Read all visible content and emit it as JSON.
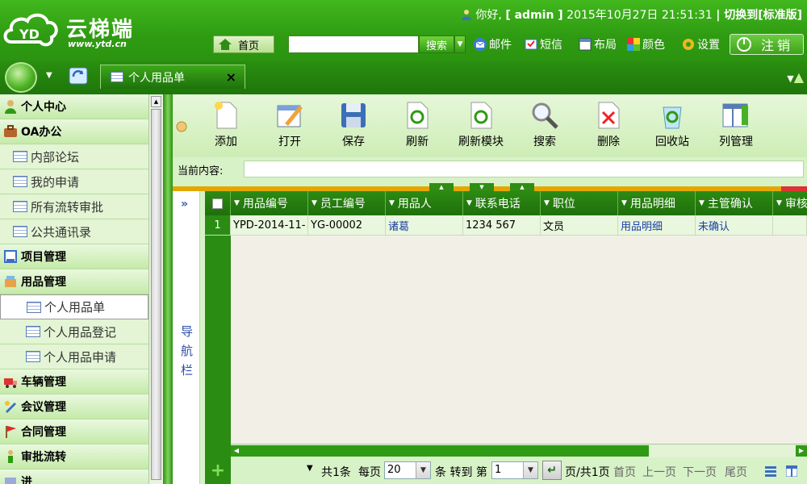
{
  "header": {
    "brand": "云梯端",
    "url": "www.ytd.cn",
    "greeting": "你好,",
    "username": "[ admin ]",
    "datetime": "2015年10月27日  21:51:31",
    "switch_label": "| 切换到[标准版]",
    "home": "首页",
    "search_placeholder": "",
    "search_btn": "搜索",
    "nav": [
      {
        "label": "邮件",
        "icon": "mail-icon"
      },
      {
        "label": "短信",
        "icon": "sms-icon"
      },
      {
        "label": "布局",
        "icon": "layout-icon"
      },
      {
        "label": "颜色",
        "icon": "color-icon"
      },
      {
        "label": "设置",
        "icon": "gear-icon"
      }
    ],
    "logout": "注销"
  },
  "tabs": [
    {
      "label": "个人用品单",
      "close": "×"
    }
  ],
  "sidebar": {
    "items": [
      {
        "label": "个人中心",
        "type": "cat",
        "icon": "user-icon"
      },
      {
        "label": "OA办公",
        "type": "cat",
        "icon": "briefcase-icon"
      },
      {
        "label": "内部论坛",
        "type": "sub",
        "icon": "grid-icon"
      },
      {
        "label": "我的申请",
        "type": "sub",
        "icon": "grid-icon"
      },
      {
        "label": "所有流转审批",
        "type": "sub",
        "icon": "grid-icon"
      },
      {
        "label": "公共通讯录",
        "type": "sub",
        "icon": "grid-icon"
      },
      {
        "label": "项目管理",
        "type": "cat2",
        "icon": "project-icon"
      },
      {
        "label": "用品管理",
        "type": "cat2",
        "icon": "supplies-icon"
      },
      {
        "label": "个人用品单",
        "type": "sub2",
        "icon": "grid-icon",
        "active": true
      },
      {
        "label": "个人用品登记",
        "type": "sub2",
        "icon": "grid-icon"
      },
      {
        "label": "个人用品申请",
        "type": "sub2",
        "icon": "grid-icon"
      },
      {
        "label": "车辆管理",
        "type": "cat2",
        "icon": "truck-icon"
      },
      {
        "label": "会议管理",
        "type": "cat2",
        "icon": "meeting-icon"
      },
      {
        "label": "合同管理",
        "type": "cat2",
        "icon": "flag-icon"
      },
      {
        "label": "审批流转",
        "type": "cat2",
        "icon": "person-icon"
      },
      {
        "label": "进",
        "type": "cat2",
        "icon": "misc-icon"
      }
    ]
  },
  "toolbar": {
    "buttons": [
      {
        "label": "添加",
        "icon": "add-doc-icon"
      },
      {
        "label": "打开",
        "icon": "open-icon"
      },
      {
        "label": "保存",
        "icon": "save-icon"
      },
      {
        "label": "刷新",
        "icon": "refresh-icon"
      },
      {
        "label": "刷新模块",
        "icon": "refresh-module-icon"
      },
      {
        "label": "搜索",
        "icon": "magnifier-icon"
      },
      {
        "label": "删除",
        "icon": "delete-icon"
      },
      {
        "label": "回收站",
        "icon": "recycle-icon"
      },
      {
        "label": "列管理",
        "icon": "columns-icon"
      }
    ],
    "current_label": "当前内容:",
    "current_value": ""
  },
  "nav_panel": {
    "toggle": "»",
    "label": "导航栏"
  },
  "grid": {
    "columns": [
      "用品编号",
      "员工编号",
      "用品人",
      "联系电话",
      "职位",
      "用品明细",
      "主管确认",
      "审核"
    ],
    "rows": [
      {
        "num": "1",
        "cells": [
          "YPD-2014-11-",
          "YG-00002",
          "诸葛",
          "1234 567",
          "文员",
          "用品明细",
          "未确认",
          ""
        ]
      }
    ]
  },
  "pager": {
    "add": "+",
    "total": "共1条",
    "per_page_label": "每页",
    "per_page": "20",
    "goto_label": "条 转到 第",
    "page": "1",
    "pages_label": "页/共1页",
    "first": "首页",
    "prev": "上一页",
    "next": "下一页",
    "last": "尾页"
  }
}
